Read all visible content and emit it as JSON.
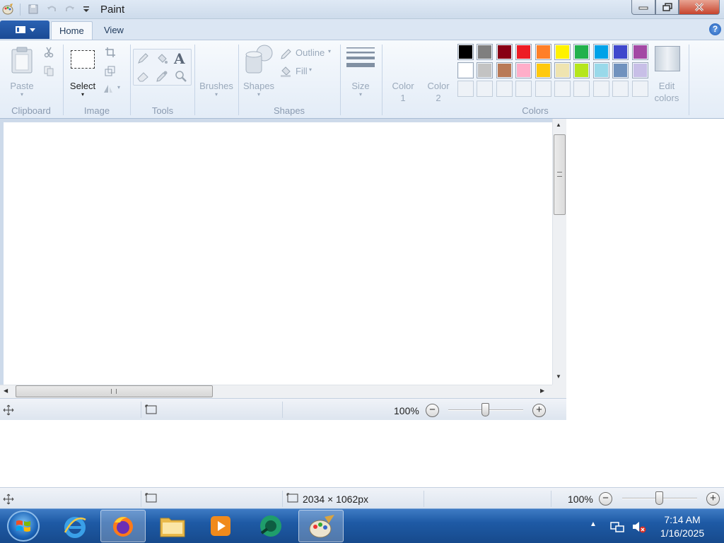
{
  "window": {
    "title": "Paint",
    "buttons": {
      "minimize": "minimize",
      "maximize": "restore",
      "close": "close"
    }
  },
  "ribbon": {
    "tabs": [
      {
        "label": "Home"
      },
      {
        "label": "View"
      }
    ],
    "clipboard": {
      "paste": "Paste",
      "group": "Clipboard"
    },
    "image": {
      "select": "Select",
      "group": "Image"
    },
    "tools": {
      "group": "Tools"
    },
    "brushes": {
      "label": "Brushes"
    },
    "shapes": {
      "label": "Shapes",
      "outline": "Outline",
      "fill": "Fill",
      "group": "Shapes"
    },
    "size": {
      "label": "Size"
    },
    "color1": {
      "line1": "Color",
      "line2": "1"
    },
    "color2": {
      "line1": "Color",
      "line2": "2"
    },
    "edit_colors": {
      "line1": "Edit",
      "line2": "colors"
    },
    "colors": {
      "group": "Colors",
      "row1": [
        "#000000",
        "#7f7f7f",
        "#880015",
        "#ed1c24",
        "#ff7f27",
        "#fff200",
        "#22b14c",
        "#00a2e8",
        "#3f48cc",
        "#a349a4"
      ],
      "row2": [
        "#ffffff",
        "#c3c3c3",
        "#b97a57",
        "#ffaec9",
        "#ffc90e",
        "#efe4b0",
        "#b5e61d",
        "#99d9ea",
        "#7092be",
        "#c8bfe7"
      ],
      "row3": [
        "",
        "",
        "",
        "",
        "",
        "",
        "",
        "",
        "",
        ""
      ]
    }
  },
  "status_inner": {
    "zoom": "100%"
  },
  "status_outer": {
    "dimensions": "2034 × 1062px",
    "zoom": "100%"
  },
  "taskbar": {
    "apps": [
      "internet-explorer",
      "firefox",
      "file-explorer",
      "media-player",
      "app-green",
      "paint"
    ],
    "clock": {
      "time": "7:14 AM",
      "date": "1/16/2025"
    }
  }
}
